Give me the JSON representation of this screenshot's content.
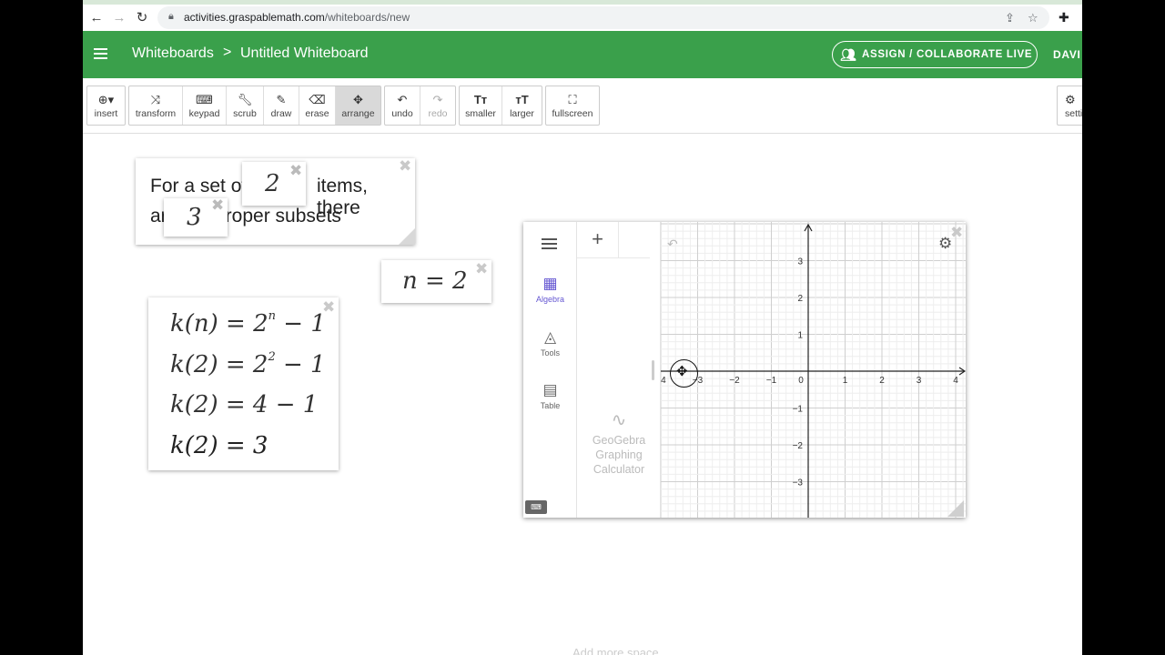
{
  "browser": {
    "url_domain": "activities.graspablemath.com",
    "url_path": "/whiteboards/new"
  },
  "header": {
    "breadcrumb_root": "Whiteboards",
    "breadcrumb_sep": ">",
    "breadcrumb_current": "Untitled Whiteboard",
    "assign_label": "ASSIGN / COLLABORATE LIVE",
    "user": "DAVI"
  },
  "toolbar": {
    "insert": "insert",
    "transform": "transform",
    "keypad": "keypad",
    "scrub": "scrub",
    "draw": "draw",
    "erase": "erase",
    "arrange": "arrange",
    "undo": "undo",
    "redo": "redo",
    "smaller": "smaller",
    "larger": "larger",
    "fullscreen": "fullscreen",
    "settings": "setti"
  },
  "sentence_card": {
    "part1": "For a set of",
    "part2": "items, there",
    "part3": "are",
    "part4": "proper subsets",
    "count_items": "2",
    "count_subsets": "3"
  },
  "n_card": {
    "expr": "n = 2"
  },
  "equation_card": {
    "line1_lhs": "k(n) = 2",
    "line1_sup": "n",
    "line1_rhs": " − 1",
    "line2_lhs": "k(2) = 2",
    "line2_sup": "2",
    "line2_rhs": " − 1",
    "line3": "k(2) = 4 − 1",
    "line4": "k(2) = 3"
  },
  "geogebra": {
    "side_algebra": "Algebra",
    "side_tools": "Tools",
    "side_table": "Table",
    "logo_line1": "GeoGebra",
    "logo_line2": "Graphing",
    "logo_line3": "Calculator",
    "x_ticks": [
      "-4",
      "-3",
      "-2",
      "-1",
      "0",
      "1",
      "2",
      "3",
      "4"
    ],
    "y_ticks": [
      "3",
      "2",
      "1",
      "-1",
      "-2",
      "-3"
    ]
  },
  "footer": {
    "add_space": "Add more space"
  },
  "icons": {
    "back": "arrow-left-icon",
    "forward": "arrow-right-icon",
    "reload": "reload-icon",
    "lock": "lock-icon",
    "share": "share-icon",
    "star": "star-icon",
    "extensions": "puzzle-icon"
  },
  "colors": {
    "header_green": "#3aa04b",
    "algebra_purple": "#6557d2"
  }
}
